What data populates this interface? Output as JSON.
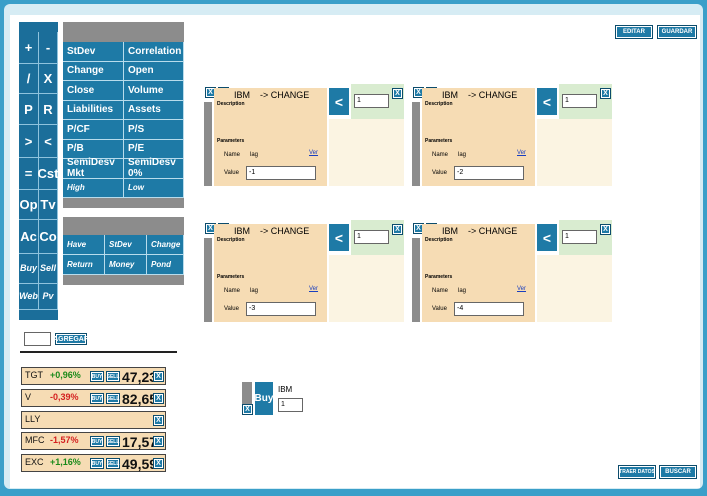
{
  "toolbar": {
    "edit_label": "EDITAR",
    "save_label": "GUARDAR",
    "fetch_data_label": "TRAER DATOS",
    "search_label": "BUSCAR"
  },
  "ops": [
    "+",
    "-",
    "/",
    "X",
    "P",
    "R",
    ">",
    "<",
    "=",
    "Cst",
    "Op",
    "Tv",
    "Ac",
    "Co",
    "Buy",
    "Sell",
    "Web",
    "Pv"
  ],
  "metrics": [
    [
      "StDev",
      "Correlation"
    ],
    [
      "Change",
      "Open"
    ],
    [
      "Close",
      "Volume"
    ],
    [
      "Liabilities",
      "Assets"
    ],
    [
      "P/CF",
      "P/S"
    ],
    [
      "P/B",
      "P/E"
    ],
    [
      "SemiDesv Mkt",
      "SemiDesv 0%"
    ],
    [
      "High",
      "Low"
    ]
  ],
  "metrics2": [
    [
      "Have",
      "StDev",
      "Change"
    ],
    [
      "Return",
      "Money",
      "Pond"
    ]
  ],
  "watchlist": {
    "add_label": "AGREGAR",
    "buy_label": "BUY",
    "sell_label": "SELL",
    "close_label": "X",
    "items": [
      {
        "symbol": "TGT",
        "change": "+0,96%",
        "price": "47,23",
        "dir": "up"
      },
      {
        "symbol": "V",
        "change": "-0,39%",
        "price": "82,65",
        "dir": "down"
      },
      {
        "symbol": "LLY",
        "change": "",
        "price": "",
        "dir": "none"
      },
      {
        "symbol": "MFC",
        "change": "-1,57%",
        "price": "17,57",
        "dir": "down"
      },
      {
        "symbol": "EXC",
        "change": "+1,16%",
        "price": "49,59",
        "dir": "up"
      }
    ]
  },
  "cards": [
    {
      "ticker": "IBM",
      "op": "-> CHANGE",
      "description_label": "Description",
      "parameters_label": "Parameters",
      "name_label": "Name",
      "param_name": "lag",
      "ver_label": "Ver",
      "value_label": "Value",
      "value": "-1",
      "n": "1"
    },
    {
      "ticker": "IBM",
      "op": "-> CHANGE",
      "description_label": "Description",
      "parameters_label": "Parameters",
      "name_label": "Name",
      "param_name": "lag",
      "ver_label": "Ver",
      "value_label": "Value",
      "value": "-2",
      "n": "1"
    },
    {
      "ticker": "IBM",
      "op": "-> CHANGE",
      "description_label": "Description",
      "parameters_label": "Parameters",
      "name_label": "Name",
      "param_name": "lag",
      "ver_label": "Ver",
      "value_label": "Value",
      "value": "-3",
      "n": "1"
    },
    {
      "ticker": "IBM",
      "op": "-> CHANGE",
      "description_label": "Description",
      "parameters_label": "Parameters",
      "name_label": "Name",
      "param_name": "lag",
      "ver_label": "Ver",
      "value_label": "Value",
      "value": "-4",
      "n": "1"
    }
  ],
  "buy_block": {
    "label": "Buy",
    "ticker": "IBM",
    "qty": "1",
    "close_label": "X"
  },
  "colors": {
    "accent": "#1e7aa6",
    "up": "#1a8a1a",
    "down": "#d42020",
    "card_bg": "#f6dcb4"
  }
}
